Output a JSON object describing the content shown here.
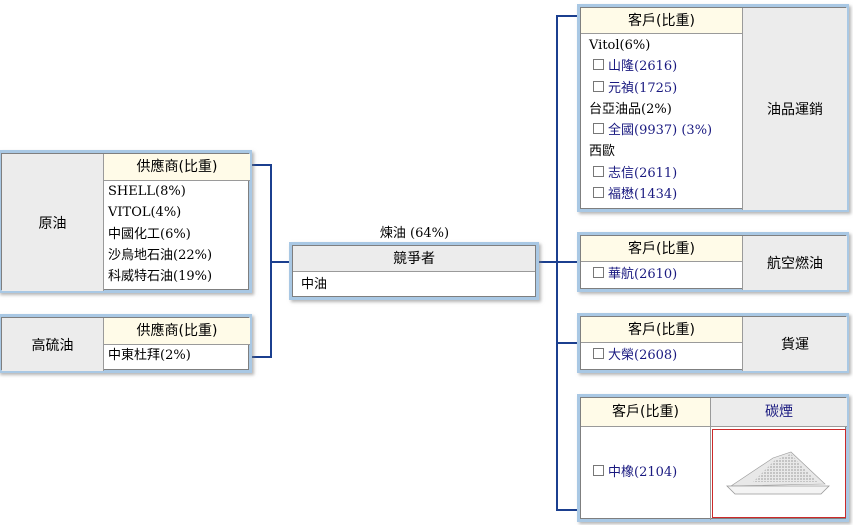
{
  "center": {
    "caption": "煉油 (64%)",
    "header": "競爭者",
    "items": [
      "中油"
    ]
  },
  "suppliers": [
    {
      "category": "原油",
      "header": "供應商(比重)",
      "items": [
        "SHELL(8%)",
        "VITOL(4%)",
        "中國化工(6%)",
        "沙烏地石油(22%)",
        "科威特石油(19%)"
      ]
    },
    {
      "category": "高硫油",
      "header": "供應商(比重)",
      "items": [
        "中東杜拜(2%)"
      ]
    }
  ],
  "customers": [
    {
      "category": "油品運銷",
      "header": "客戶(比重)",
      "rows": [
        {
          "text": "Vitol(6%)",
          "checkbox": false
        },
        {
          "text": "山隆(2616)",
          "checkbox": true
        },
        {
          "text": "元禎(1725)",
          "checkbox": true
        },
        {
          "text": "台亞油品(2%)",
          "checkbox": false
        },
        {
          "text": "全國(9937) (3%)",
          "checkbox": true
        },
        {
          "text": "西歐",
          "checkbox": false
        },
        {
          "text": "志信(2611)",
          "checkbox": true
        },
        {
          "text": "福懋(1434)",
          "checkbox": true
        }
      ]
    },
    {
      "category": "航空燃油",
      "header": "客戶(比重)",
      "rows": [
        {
          "text": "華航(2610)",
          "checkbox": true
        }
      ]
    },
    {
      "category": "貨運",
      "header": "客戶(比重)",
      "rows": [
        {
          "text": "大榮(2608)",
          "checkbox": true
        }
      ]
    },
    {
      "category": "碳煙",
      "header": "客戶(比重)",
      "rows": [
        {
          "text": "中橡(2104)",
          "checkbox": true
        }
      ]
    }
  ]
}
